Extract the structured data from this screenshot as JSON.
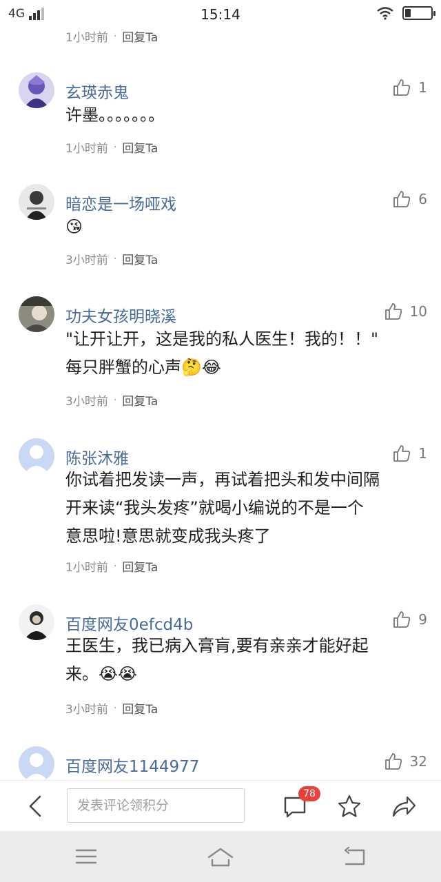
{
  "status_bar": {
    "network": "4G",
    "time": "15:14"
  },
  "top_meta": {
    "time": "1小时前",
    "separator": "·",
    "reply": "回复Ta"
  },
  "comments": [
    {
      "name": "玄瑛赤鬼",
      "likes": "1",
      "text_lines": [
        "许墨。。。。。。。"
      ],
      "time": "1小时前",
      "separator": "·",
      "reply": "回复Ta",
      "avatar_color": "#7d6fc7"
    },
    {
      "name": "暗恋是一场哑戏",
      "likes": "6",
      "text_lines": [
        "😘"
      ],
      "time": "3小时前",
      "separator": "·",
      "reply": "回复Ta",
      "avatar_color": "#2b2b2b"
    },
    {
      "name": "功夫女孩明晓溪",
      "likes": "10",
      "text_lines": [
        "\"让开让开，这是我的私人医生！我的！！\"",
        "每只胖蟹的心声🤔😂"
      ],
      "time": "3小时前",
      "separator": "·",
      "reply": "回复Ta",
      "avatar_color": "#5c5c52"
    },
    {
      "name": "陈张沐雅",
      "likes": "1",
      "text_lines": [
        "你试着把发读一声，再试着把头和发中间隔",
        "开来读“我头发疼”就喝小编说的不是一个",
        "意思啦!意思就变成我头疼了"
      ],
      "time": "1小时前",
      "separator": "·",
      "reply": "回复Ta",
      "avatar_color": "#c9d8f5"
    },
    {
      "name": "百度网友0efcd4b",
      "likes": "9",
      "text_lines": [
        "王医生，我已病入膏肓,要有亲亲才能好起",
        "来。😭😭"
      ],
      "time": "3小时前",
      "separator": "·",
      "reply": "回复Ta",
      "avatar_color": "#1f1f1f"
    },
    {
      "name": "百度网友1144977",
      "likes": "32",
      "text_lines": [],
      "time": "",
      "separator": "",
      "reply": "",
      "avatar_color": "#c9d8f5"
    }
  ],
  "bottom_bar": {
    "input_placeholder": "发表评论领积分",
    "comment_count": "78"
  },
  "icons": {
    "like": "thumbs-up-icon",
    "back": "chevron-left-icon",
    "comment": "comment-bubble-icon",
    "favorite": "star-icon",
    "share": "share-arrow-icon",
    "menu": "menu-icon",
    "home": "home-icon",
    "nav_back": "return-icon"
  },
  "colors": {
    "username": "#4a6b9a",
    "badge": "#e8413b",
    "meta": "#8a8a8a"
  }
}
